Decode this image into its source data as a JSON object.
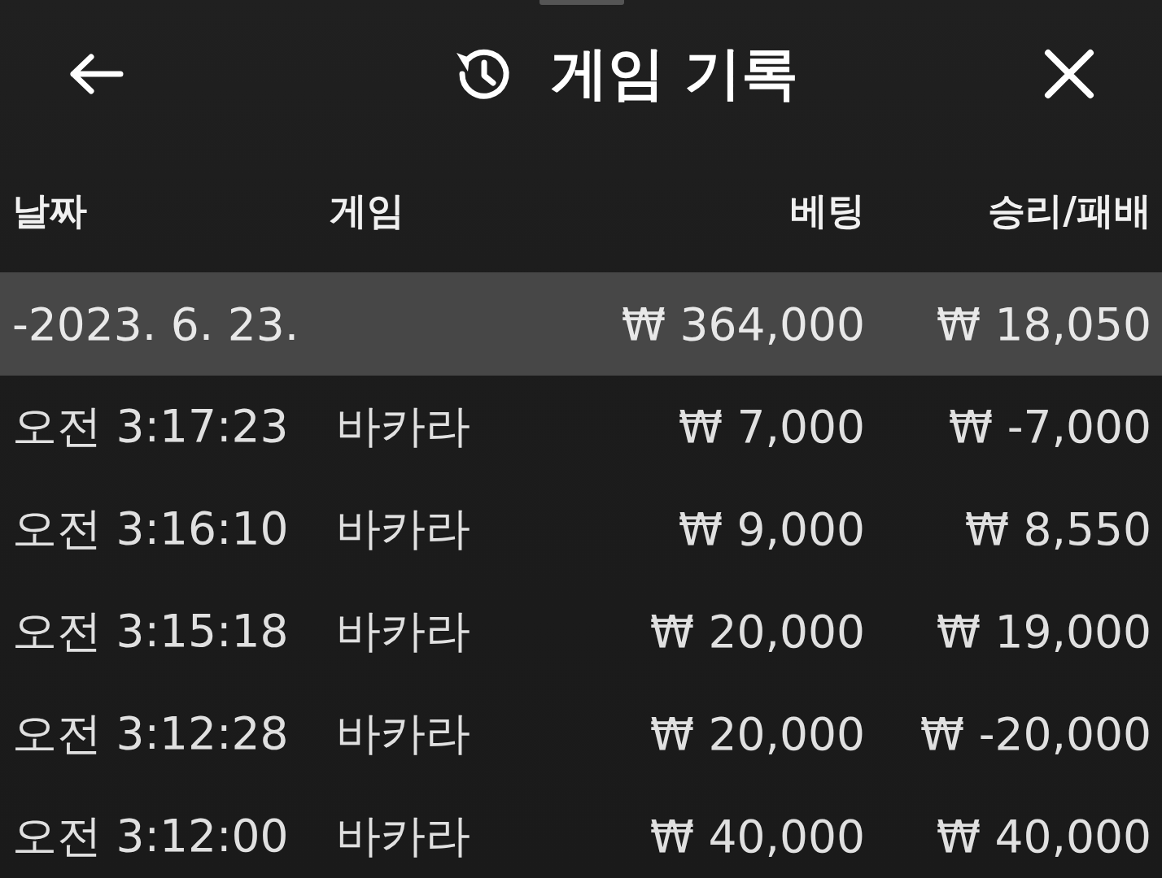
{
  "header": {
    "title": "게임 기록"
  },
  "columns": [
    "날짜",
    "게임",
    "베팅",
    "승리/패배"
  ],
  "groups": [
    {
      "date": "-2023. 6. 23.",
      "bet": "₩ 364,000",
      "result": "₩ 18,050",
      "rows": [
        {
          "time": "오전 3:17:23",
          "game": "바카라",
          "bet": "₩ 7,000",
          "result": "₩ -7,000"
        },
        {
          "time": "오전 3:16:10",
          "game": "바카라",
          "bet": "₩ 9,000",
          "result": "₩ 8,550"
        },
        {
          "time": "오전 3:15:18",
          "game": "바카라",
          "bet": "₩ 20,000",
          "result": "₩ 19,000"
        },
        {
          "time": "오전 3:12:28",
          "game": "바카라",
          "bet": "₩ 20,000",
          "result": "₩ -20,000"
        },
        {
          "time": "오전 3:12:00",
          "game": "바카라",
          "bet": "₩ 40,000",
          "result": "₩ 40,000"
        }
      ]
    }
  ]
}
